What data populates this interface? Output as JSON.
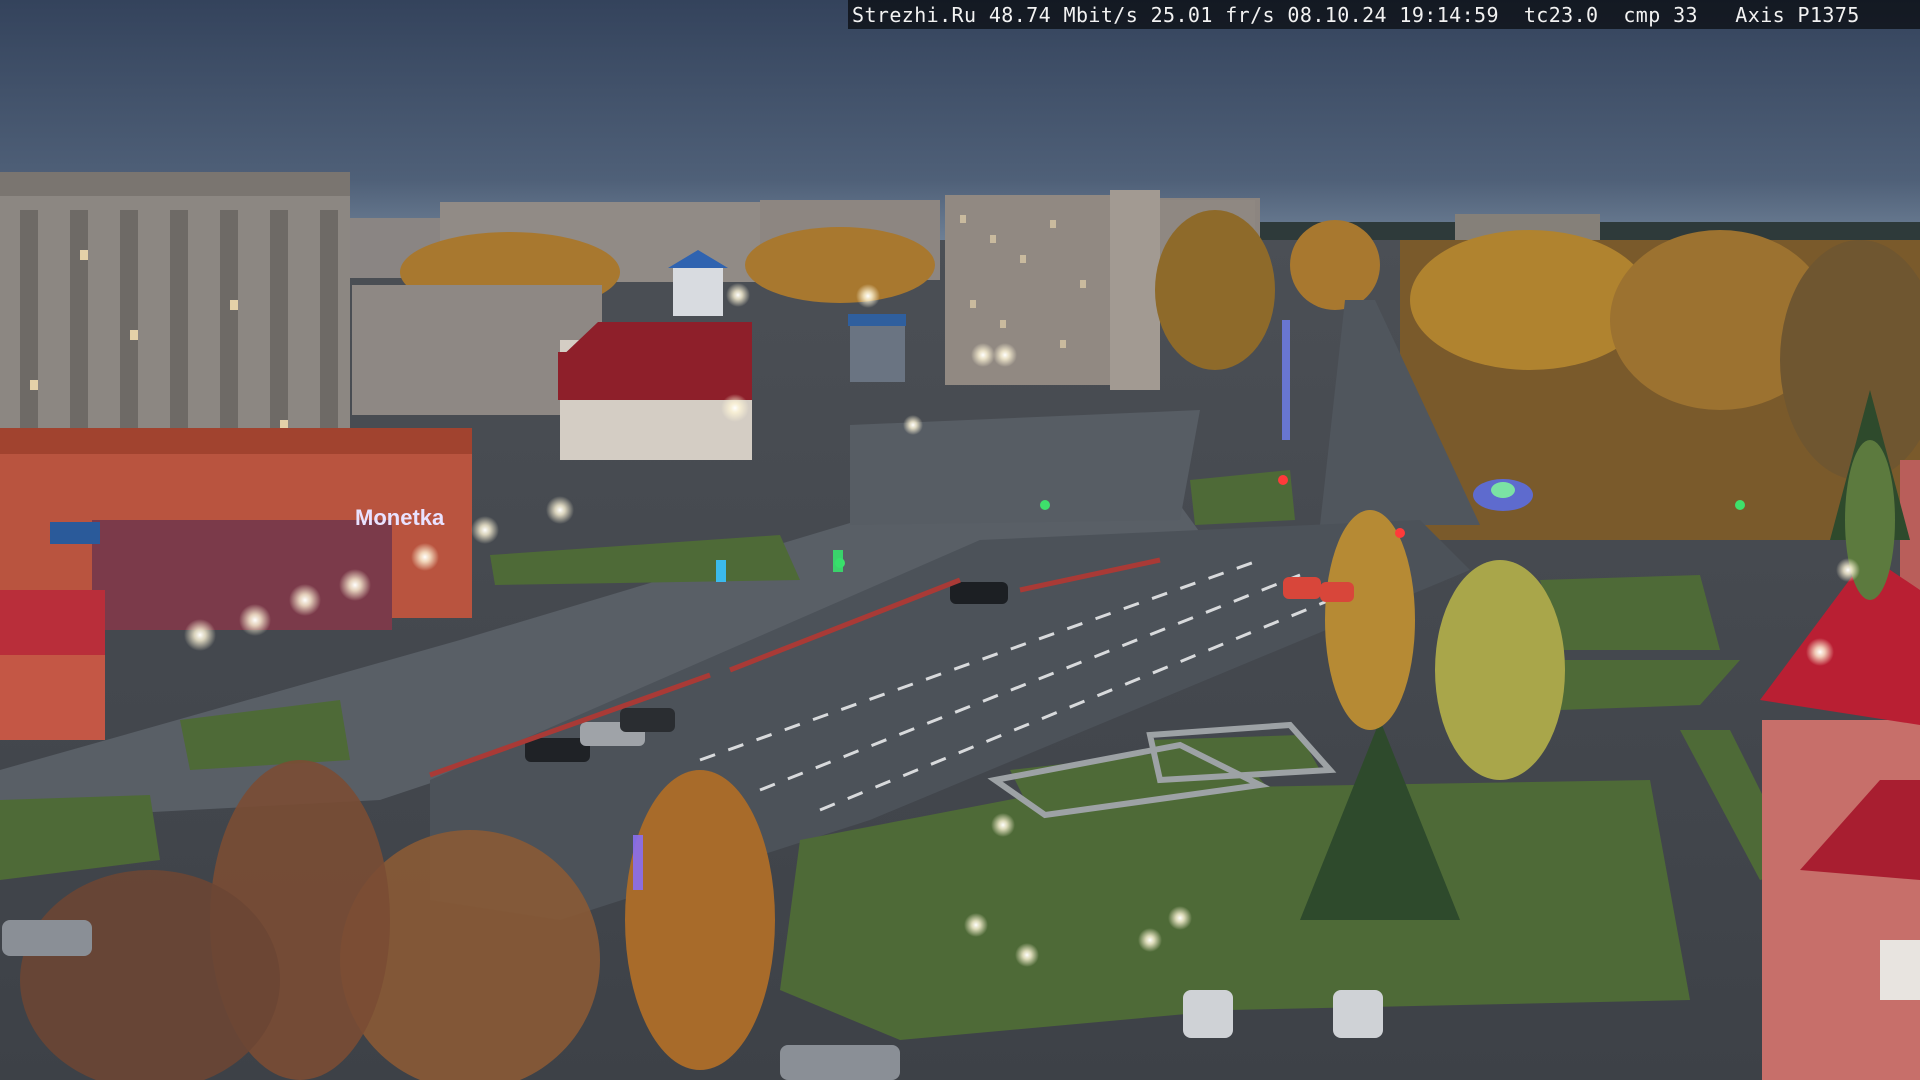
{
  "overlay": {
    "text": "Strezhi.Ru 48.74 Mbit/s 25.01 fr/s 08.10.24 19:14:59  tc23.0  cmp 33   Axis P1375"
  },
  "scene": {
    "storefront_sign": "Monetka",
    "colors": {
      "sky_top": "#3b4a63",
      "sky_horizon": "#6b7f96",
      "road": "#4a5057",
      "grass": "#4f6a3a",
      "autumn_foliage": "#b07a2c",
      "building_facade": "#8f8a86",
      "red_roof": "#8e1f2a",
      "pink_building": "#c76f6a"
    }
  }
}
